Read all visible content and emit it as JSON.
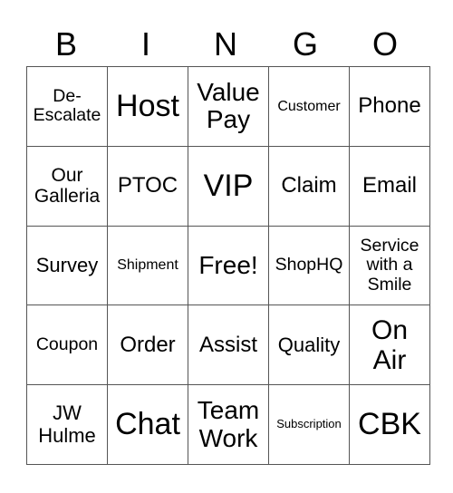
{
  "header": [
    "B",
    "I",
    "N",
    "G",
    "O"
  ],
  "rows": [
    [
      "De-\nEscalate",
      "Host",
      "Value\nPay",
      "Customer",
      "Phone"
    ],
    [
      "Our\nGalleria",
      "PTOC",
      "VIP",
      "Claim",
      "Email"
    ],
    [
      "Survey",
      "Shipment",
      "Free!",
      "ShopHQ",
      "Service\nwith a\nSmile"
    ],
    [
      "Coupon",
      "Order",
      "Assist",
      "Quality",
      "On\nAir"
    ],
    [
      "JW\nHulme",
      "Chat",
      "Team\nWork",
      "Subscription",
      "CBK"
    ]
  ]
}
